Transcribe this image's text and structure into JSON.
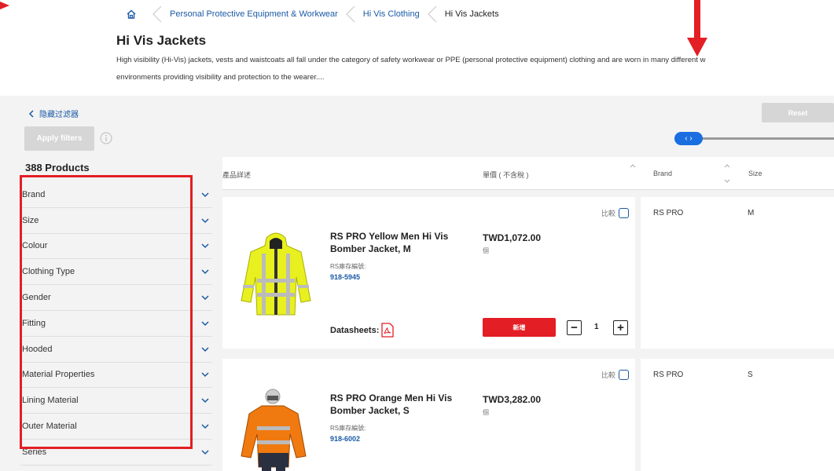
{
  "breadcrumb": {
    "items": [
      "Personal Protective Equipment & Workwear",
      "Hi Vis Clothing"
    ],
    "current": "Hi Vis Jackets"
  },
  "page": {
    "title": "Hi Vis Jackets",
    "description_line1": "High visibility (Hi-Vis) jackets, vests and waistcoats all fall under the category of safety workwear or PPE (personal protective equipment) clothing and are worn in many different w",
    "description_line2": "environments providing visibility and protection to the wearer...."
  },
  "filters": {
    "hide_label": "隐藏过滤器",
    "apply_label": "Apply filters",
    "reset_label": "Reset",
    "products_count": "388 Products",
    "items": [
      "Brand",
      "Size",
      "Colour",
      "Clothing Type",
      "Gender",
      "Fitting",
      "Hooded",
      "Material Properties",
      "Lining Material",
      "Outer Material",
      "Series"
    ]
  },
  "table": {
    "col_details": "產品詳述",
    "col_price": "單價 ( 不含稅 )",
    "col_brand": "Brand",
    "col_size": "Size"
  },
  "products": [
    {
      "name": "RS PRO Yellow Men Hi Vis Bomber Jacket, M",
      "stock_label": "RS庫存編號:",
      "stock_no": "918-5945",
      "price": "TWD1,072.00",
      "unit": "個",
      "datasheets_label": "Datasheets:",
      "add_label": "新增",
      "qty": "1",
      "compare_label": "比較",
      "brand": "RS PRO",
      "size": "M",
      "jacket_color": "#e8f020"
    },
    {
      "name": "RS PRO Orange Men Hi Vis Bomber Jacket, S",
      "stock_label": "RS庫存編號:",
      "stock_no": "918-6002",
      "compare_label": "比較",
      "price": "TWD3,282.00",
      "unit": "個",
      "brand": "RS PRO",
      "size": "S",
      "jacket_color": "#f07a10"
    }
  ],
  "colors": {
    "accent_blue": "#1a5aa6",
    "accent_red": "#e31e24",
    "background_gray": "#f3f3f3"
  }
}
